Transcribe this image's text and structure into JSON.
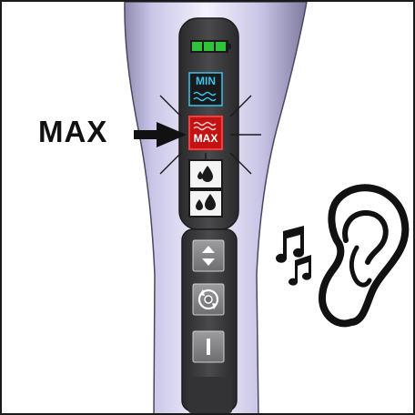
{
  "callout": {
    "label": "MAX"
  },
  "device": {
    "battery_level": 1.0,
    "modes": [
      {
        "label": "MIN",
        "state": "off"
      },
      {
        "label": "MAX",
        "state": "selected-blinking"
      }
    ],
    "buttons": [
      {
        "icon": "water-drop-mode-icon"
      },
      {
        "icon": "up-down-arrows-icon"
      },
      {
        "icon": "rotating-swirl-icon"
      },
      {
        "icon": "power-icon"
      }
    ]
  },
  "colors": {
    "handle": "#c8c4e6",
    "panel": "#3e3e40",
    "min_accent": "#3bc3ee",
    "max_accent": "#e02020",
    "battery": "#2fc33a"
  },
  "icons": [
    "arrow-right-icon",
    "music-notes-icon",
    "ear-icon"
  ]
}
